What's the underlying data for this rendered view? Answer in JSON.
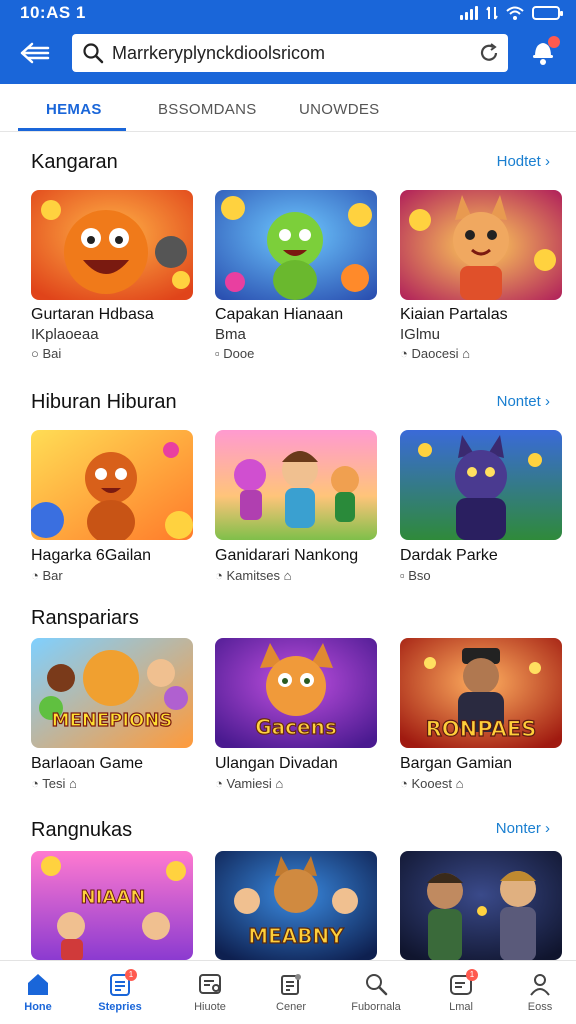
{
  "status_bar": {
    "time": "10:AS 1"
  },
  "search": {
    "url": "Marrkeryplynckdioolsricom"
  },
  "tabs": [
    {
      "label": "HEMAS",
      "active": true
    },
    {
      "label": "BSSOMDANS",
      "active": false
    },
    {
      "label": "UNOWDES",
      "active": false
    }
  ],
  "sections": [
    {
      "title": "Kangaran",
      "more_label": "Hodtet",
      "cards": [
        {
          "title": "Gurtaran Hdbasa",
          "subtitle": "IKplaoeaa",
          "meta": "Bai"
        },
        {
          "title": "Capakan Hianaan",
          "subtitle": "Bma",
          "meta": "Dooe"
        },
        {
          "title": "Kiaian Partalas",
          "subtitle": "IGlmu",
          "meta": "Daocesi"
        }
      ]
    },
    {
      "title": "Hiburan Hiburan",
      "more_label": "Nontet",
      "cards": [
        {
          "title": "Hagarka 6Gailan",
          "subtitle": "",
          "meta": "Bar"
        },
        {
          "title": "Ganidarari Nankong",
          "subtitle": "",
          "meta": "Kamitses"
        },
        {
          "title": "Dardak Parke",
          "subtitle": "",
          "meta": "Bso"
        }
      ]
    },
    {
      "title": "Ranspariars",
      "more_label": "",
      "cards": [
        {
          "title": "Barlaoan Game",
          "subtitle": "",
          "meta": "Tesi",
          "art_text": "MENEPIONS"
        },
        {
          "title": "Ulangan Divadan",
          "subtitle": "",
          "meta": "Vamiesi",
          "art_text": "Gacens"
        },
        {
          "title": "Bargan Gamian",
          "subtitle": "",
          "meta": "Kooest",
          "art_text": "RONPAES"
        }
      ]
    },
    {
      "title": "Rangnukas",
      "more_label": "Nonter",
      "cards": [
        {
          "title": "",
          "subtitle": "",
          "meta": "",
          "art_text": "NIAAN"
        },
        {
          "title": "",
          "subtitle": "",
          "meta": "",
          "art_text": "MEABNY"
        },
        {
          "title": "",
          "subtitle": "",
          "meta": ""
        }
      ]
    }
  ],
  "bottom_nav": [
    {
      "label": "Hone",
      "icon": "home-icon",
      "active": true
    },
    {
      "label": "Stepries",
      "icon": "stories-icon",
      "active": false,
      "badge": "1"
    },
    {
      "label": "Hiuote",
      "icon": "quote-icon",
      "active": false
    },
    {
      "label": "Cener",
      "icon": "center-icon",
      "active": false
    },
    {
      "label": "Fubornala",
      "icon": "search-icon",
      "active": false
    },
    {
      "label": "Lmal",
      "icon": "mail-icon",
      "active": false,
      "badge": "1"
    },
    {
      "label": "Eoss",
      "icon": "profile-icon",
      "active": false
    }
  ],
  "colors": {
    "primary": "#1a66d9",
    "link": "#1a7fd0",
    "badge": "#ff5a4f"
  }
}
